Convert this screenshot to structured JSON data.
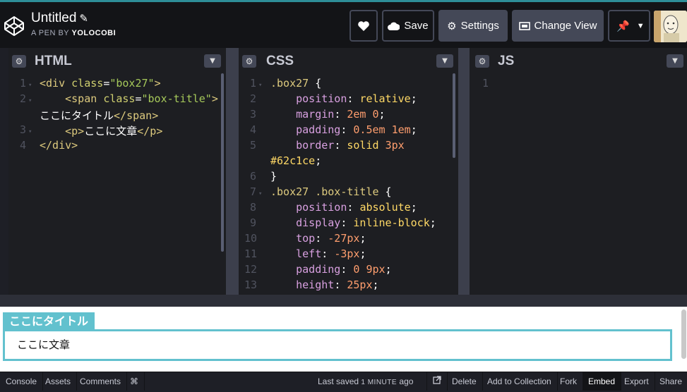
{
  "header": {
    "title": "Untitled",
    "pen_by_prefix": "A PEN BY",
    "author": "YOLOCOBI",
    "save_label": "Save",
    "settings_label": "Settings",
    "change_view_label": "Change View"
  },
  "panes": {
    "html": {
      "title": "HTML"
    },
    "css": {
      "title": "CSS"
    },
    "js": {
      "title": "JS"
    }
  },
  "html_code": {
    "line_numbers": [
      "1",
      "2",
      "3",
      "4"
    ],
    "lines": [
      [
        "<div ",
        "class",
        "=",
        "\"box27\"",
        ">"
      ],
      [
        "    <span ",
        "class",
        "=",
        "\"box-title\"",
        ">"
      ],
      [
        "ここにタイトル",
        "</span>"
      ],
      [
        "    <p>",
        "ここに文章",
        "</p>"
      ],
      [
        "</div>"
      ]
    ]
  },
  "css_code": {
    "line_numbers": [
      "1",
      "2",
      "3",
      "4",
      "5",
      "",
      "6",
      "7",
      "8",
      "9",
      "10",
      "11",
      "12",
      "13"
    ],
    "lines": [
      [
        ".box27",
        " {"
      ],
      [
        "    position",
        ": ",
        "relative",
        ";"
      ],
      [
        "    margin",
        ": ",
        "2em 0",
        ";"
      ],
      [
        "    padding",
        ": ",
        "0.5em 1em",
        ";"
      ],
      [
        "    border",
        ": ",
        "solid ",
        "3px"
      ],
      [
        "#62c1ce",
        ";"
      ],
      [
        "}"
      ],
      [
        ".box27 .box-title",
        " {"
      ],
      [
        "    position",
        ": ",
        "absolute",
        ";"
      ],
      [
        "    display",
        ": ",
        "inline-block",
        ";"
      ],
      [
        "    top",
        ": ",
        "-27px",
        ";"
      ],
      [
        "    left",
        ": ",
        "-3px",
        ";"
      ],
      [
        "    padding",
        ": ",
        "0 9px",
        ";"
      ],
      [
        "    height",
        ": ",
        "25px",
        ";"
      ]
    ]
  },
  "js_code": {
    "line_numbers": [
      "1"
    ]
  },
  "preview": {
    "box_title": "ここにタイトル",
    "box_text": "ここに文章"
  },
  "footer": {
    "console": "Console",
    "assets": "Assets",
    "comments": "Comments",
    "shortcut_symbol": "⌘",
    "last_saved": "Last saved",
    "minute": "1 MINUTE",
    "ago": "ago",
    "delete": "Delete",
    "add_to_collection": "Add to Collection",
    "fork": "Fork",
    "embed": "Embed",
    "export": "Export",
    "share": "Share"
  },
  "colors": {
    "accent": "#62c1ce",
    "header_bg": "#131417",
    "button_bg": "#444857"
  }
}
